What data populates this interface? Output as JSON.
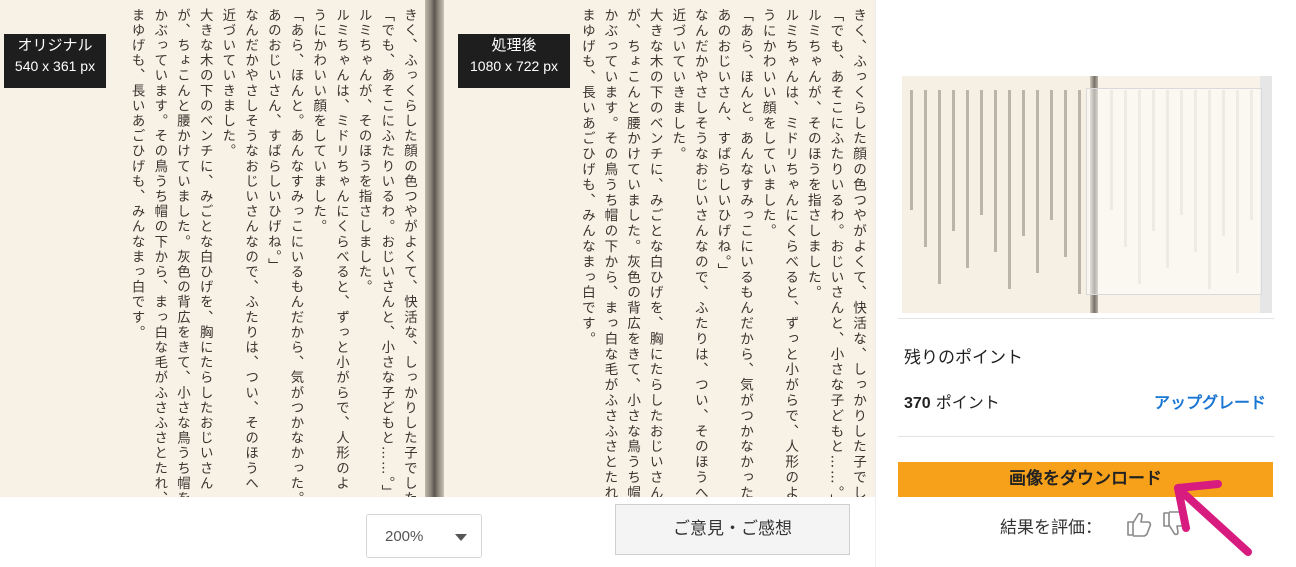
{
  "original_badge": {
    "label": "オリジナル",
    "size": "540 x 361 px"
  },
  "processed_badge": {
    "label": "処理後",
    "size": "1080 x 722 px"
  },
  "page_text_left": [
    "きく、ふっくらした顔の色つやがよくて、快活な、しっかりした子でした。",
    "「でも、あそこにふたりいるわ。おじいさんと、小さな子どもと……。」",
    "ルミちゃんが、そのほうを指さしました。",
    "ルミちゃんは、ミドリちゃんにくらべると、ずっと小がらで、人形のよ",
    "うにかわいい顔をしていました。",
    "「あら、ほんと。あんなすみっこにいるもんだから、気がつかなかった。",
    "あのおじいさん、すばらしいひげね。」",
    "なんだかやさしそうなおじいさんなので、ふたりは、つい、そのほうへ",
    "近づいていきました。",
    "大きな木の下のベンチに、みごとな白ひげを、胸にたらしたおじいさん",
    "が、ちょこんと腰かけていました。灰色の背広をきて、小さな鳥うち帽を",
    "かぶっています。その鳥うち帽の下から、まっ白な毛がふさふさとたれ、",
    "まゆげも、長いあごひげも、みんなまっ白です。"
  ],
  "page_text_right": [
    "きく、ふっくらした顔の色つやがよくて、快活な、しっかりした子でした。",
    "「でも、あそこにふたりいるわ。おじいさんと、小さな子どもと……。」",
    "ルミちゃんが、そのほうを指さしました。",
    "ルミちゃんは、ミドリちゃんにくらべると、ずっと小がらで、人形のよ",
    "うにかわいい顔をしていました。",
    "「あら、ほんと。あんなすみっこにいるもんだから、気がつかなかった。",
    "あのおじいさん、すばらしいひげね。」",
    "なんだかやさしそうなおじいさんなので、ふたりは、つい、そのほうへ",
    "近づいていきました。",
    "大きな木の下のベンチに、みごとな白ひげを、胸にたらしたおじいさん",
    "が、ちょこんと腰かけていました。灰色の背広をきて、小さな鳥うち帽を",
    "かぶっています。その鳥うち帽の下から、まっ白な毛がふさふさとたれ、",
    "まゆげも、長いあごひげも、みんなまっ白です。"
  ],
  "zoom": {
    "value": "200%"
  },
  "feedback_button": "ご意見・ご感想",
  "sidebar": {
    "remaining_label": "残りのポイント",
    "points_value": "370",
    "points_unit": "ポイント",
    "upgrade_link": "アップグレード",
    "download_button": "画像をダウンロード",
    "rate_label": "結果を評価："
  },
  "icons": {
    "like": "thumbs-up-icon",
    "dislike": "thumbs-down-icon",
    "annotation": "pink-arrow-annotation"
  },
  "colors": {
    "download_button": "#f7a11a",
    "upgrade_link": "#1976d2",
    "annotation_arrow": "#d81b7f",
    "badge_bg": "#1e1e1e"
  }
}
